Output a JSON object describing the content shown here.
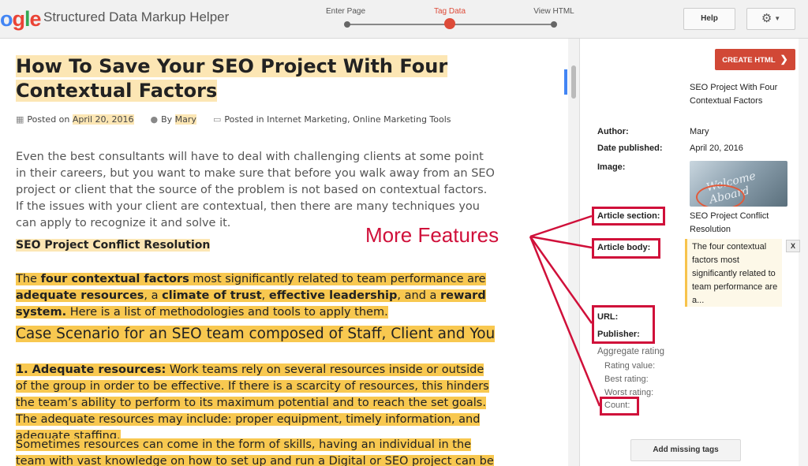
{
  "header": {
    "logo_text": "ogle",
    "app_title": "Structured Data Markup Helper",
    "steps": [
      {
        "label": "Enter Page",
        "active": false
      },
      {
        "label": "Tag Data",
        "active": true
      },
      {
        "label": "View HTML",
        "active": false
      }
    ],
    "help_label": "Help",
    "settings_icon": "gear-icon"
  },
  "article": {
    "title": "How To Save Your SEO Project With Four Contextual Factors",
    "meta": {
      "posted_on_prefix": "Posted on",
      "date": "April 20, 2016",
      "by_prefix": "By",
      "author": "Mary",
      "posted_in_prefix": "Posted in",
      "categories": "Internet Marketing, Online Marketing Tools"
    },
    "intro": "Even the best consultants will have to deal with challenging clients at some point in their careers, but you want to make sure that before you walk away from an SEO project or client that the source of the problem is not based on contextual factors. If the issues with your client are contextual, then there are many techniques you can apply to recognize it and solve it.",
    "section_heading": "SEO Project Conflict Resolution",
    "p2": {
      "t1": "The ",
      "b1": "four contextual factors",
      "t2": " most significantly related to team performance are ",
      "b2": "adequate resources",
      "t3": ", a ",
      "b3": "climate of trust",
      "t4": ", ",
      "b4": "effective leadership",
      "t5": ", and a ",
      "b5": "reward system.",
      "t6": " Here is a list of methodologies and tools to apply them."
    },
    "case_heading": "Case Scenario for an SEO team composed of Staff, Client and You",
    "p3": {
      "b1": "1. Adequate resources:",
      "t1": " Work teams rely on several resources inside or outside of the group in order to be effective. If there is a scarcity of resources, this hinders the team’s ability to perform to its maximum potential and to reach the set goals. The adequate resources may include: proper equipment, timely information, and adequate staffing."
    },
    "p4": "Sometimes resources can come in the form of skills, having an individual in the team with vast knowledge on how to set up  and run a Digital or SEO project can be by far the"
  },
  "panel": {
    "create_label": "CREATE HTML",
    "title_value": "SEO Project With Four Contextual Factors",
    "author_label": "Author:",
    "author_value": "Mary",
    "date_label": "Date published:",
    "date_value": "April 20, 2016",
    "image_label": "Image:",
    "image_text": "Welcome Aboard",
    "section_label": "Article section:",
    "section_value": "SEO Project Conflict Resolution",
    "body_label": "Article body:",
    "body_value": "The four contextual factors most significantly related to team performance are a...",
    "remove_label": "X",
    "url_label": "URL:",
    "publisher_label": "Publisher:",
    "aggregate_label": "Aggregate rating",
    "rating_value_label": "Rating value:",
    "best_rating_label": "Best rating:",
    "worst_rating_label": "Worst rating:",
    "count_label": "Count:",
    "add_missing_label": "Add missing tags"
  },
  "annotation": {
    "text": "More Features",
    "color": "#d0103a"
  }
}
